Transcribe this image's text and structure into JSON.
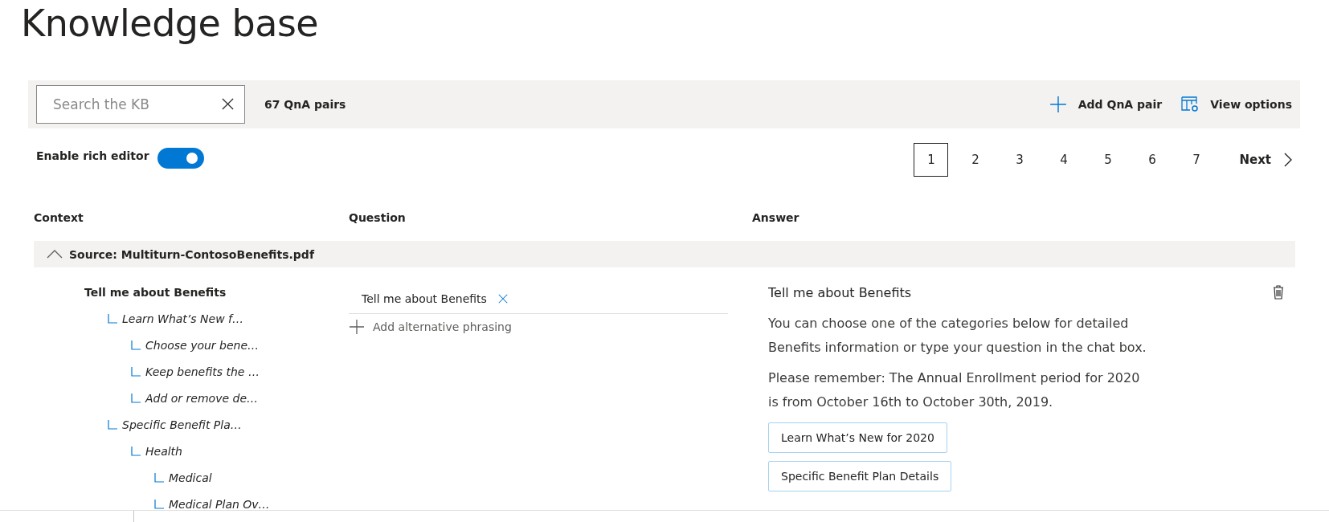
{
  "title": "Knowledge base",
  "toolbar": {
    "search": {
      "placeholder": "Search the KB"
    },
    "count": "67 QnA pairs",
    "actions": [
      {
        "kind": "add",
        "label": "Add QnA pair"
      },
      {
        "kind": "view",
        "label": "View options"
      }
    ]
  },
  "rich_editor": {
    "label": "Enable rich editor",
    "on": true
  },
  "pagination": {
    "pages": [
      {
        "label": "1",
        "selected": true
      },
      {
        "label": "2",
        "selected": false
      },
      {
        "label": "3",
        "selected": false
      },
      {
        "label": "4",
        "selected": false
      },
      {
        "label": "5",
        "selected": false
      },
      {
        "label": "6",
        "selected": false
      },
      {
        "label": "7",
        "selected": false
      }
    ],
    "next": "Next"
  },
  "table": {
    "columns": [
      "Context",
      "Question",
      "Answer"
    ],
    "source": {
      "label": "Source: Multiturn-ContosoBenefits.pdf",
      "expanded": true
    },
    "row": {
      "context": {
        "label": "Tell me about Benefits",
        "children": [
          {
            "label": "Learn What’s New f…",
            "children": [
              {
                "label": "Choose your bene…"
              },
              {
                "label": "Keep benefits the …"
              },
              {
                "label": "Add or remove de…"
              }
            ]
          },
          {
            "label": "Specific Benefit Pla…",
            "children": [
              {
                "label": "Health",
                "children": [
                  {
                    "label": "Medical"
                  },
                  {
                    "label": "Medical Plan Ov…"
                  }
                ]
              }
            ]
          }
        ]
      },
      "questions": [
        "Tell me about Benefits"
      ],
      "add_phrasing": "Add alternative phrasing",
      "answer": {
        "heading": "Tell me about Benefits",
        "paragraphs": [
          "You can choose one of the categories below for detailed Benefits information or type your question in the chat box.",
          "Please remember: The Annual Enrollment period for 2020 is from October 16th to October 30th, 2019."
        ],
        "prompts": [
          "Learn What’s New for 2020",
          "Specific Benefit Plan Details"
        ]
      }
    }
  }
}
